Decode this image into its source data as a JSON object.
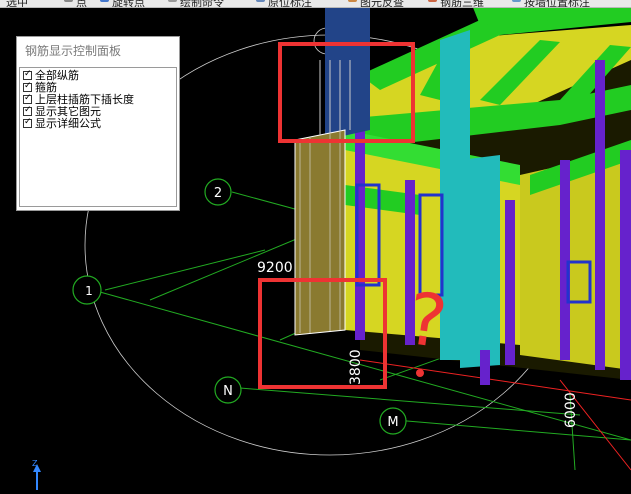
{
  "toolbar": {
    "items": [
      "选中",
      "点",
      "旋转点",
      "绘制命令",
      "原位标注",
      "图元反查",
      "钢筋三维",
      "按墙位置标注"
    ]
  },
  "rebar_panel": {
    "title": "钢筋显示控制面板",
    "options": [
      {
        "label": "全部纵筋",
        "checked": true
      },
      {
        "label": "箍筋",
        "checked": true
      },
      {
        "label": "上层柱插筋下插长度",
        "checked": true
      },
      {
        "label": "显示其它图元",
        "checked": true
      },
      {
        "label": "显示详细公式",
        "checked": true
      }
    ]
  },
  "scene": {
    "axis_markers": [
      "2",
      "1",
      "N",
      "M"
    ],
    "dimensions": [
      "9200",
      "3800",
      "6000"
    ],
    "annotation_mark": "?",
    "axis_indicator": "Z",
    "colors": {
      "beam_green": "#22cc22",
      "slab_yellow": "#dddd22",
      "column_cyan": "#22bbbb",
      "rebar_purple": "#6622cc",
      "highlight_red": "#ee3333",
      "grid_green": "#22aa22"
    }
  }
}
